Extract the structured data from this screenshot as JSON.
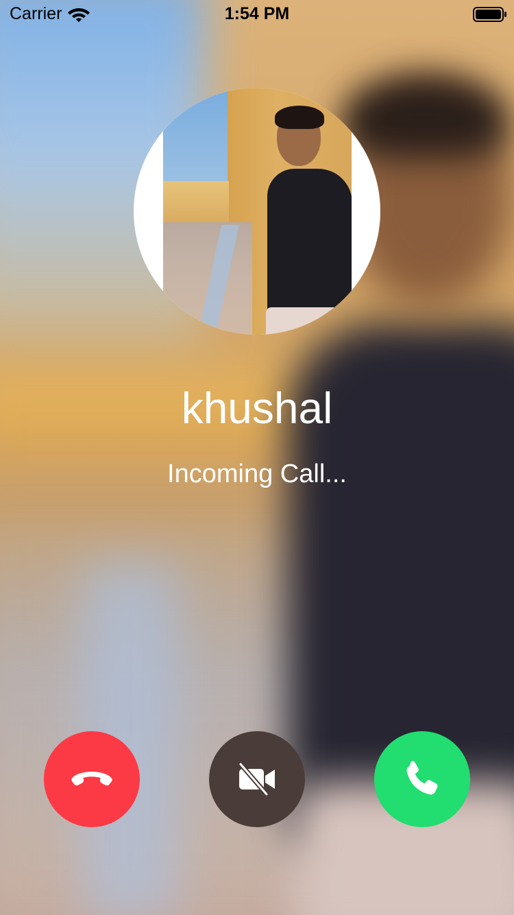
{
  "status_bar": {
    "carrier": "Carrier",
    "time": "1:54 PM",
    "wifi_icon": "wifi-icon",
    "battery_icon": "battery-icon"
  },
  "caller": {
    "name": "khushal",
    "status": "Incoming Call..."
  },
  "actions": {
    "decline": {
      "icon": "phone-hangup-icon",
      "color": "#fc3a45"
    },
    "video": {
      "icon": "video-off-icon",
      "color": "#4a3d39"
    },
    "accept": {
      "icon": "phone-icon",
      "color": "#22dd70"
    }
  }
}
